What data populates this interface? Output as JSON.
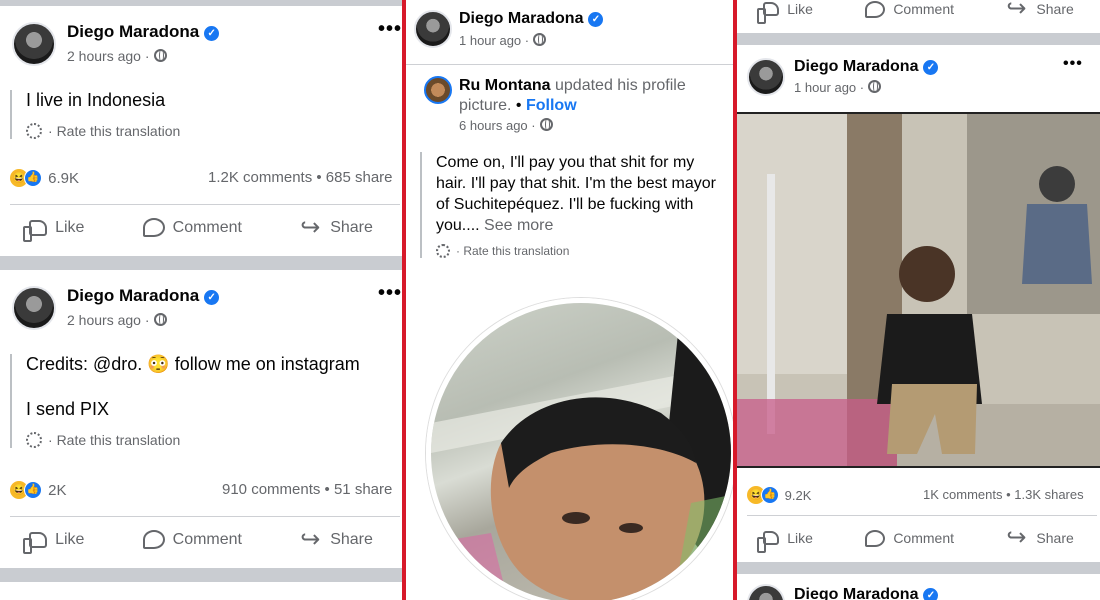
{
  "panel1": {
    "post1": {
      "author": "Diego Maradona",
      "time": "2 hours ago",
      "text": "I live in Indonesia",
      "rate": "Rate this translation",
      "reaction_count": "6.9K",
      "counts": "1.2K comments • 685 share"
    },
    "post2": {
      "author": "Diego Maradona",
      "time": "2 hours ago",
      "text_line1": "Credits: @dro. 😳 follow me on instagram",
      "text_line2": "I send PIX",
      "rate": "Rate this translation",
      "reaction_count": "2K",
      "counts": "910 comments • 51 share"
    }
  },
  "panel2": {
    "author": "Diego Maradona",
    "time": "1 hour ago",
    "shared_author": "Ru Montana",
    "shared_action_1": "updated his profile",
    "shared_action_2": "picture.",
    "follow": "Follow",
    "shared_time": "6 hours ago",
    "text_lines": [
      "Come on, I'll pay you that shit for my",
      "hair. I'll pay that shit. I'm the best mayor",
      "of Suchitepéquez. I'll be fucking with",
      "you...."
    ],
    "see_more": "See more",
    "rate": "Rate this translation"
  },
  "panel3": {
    "author": "Diego Maradona",
    "time": "1 hour ago",
    "reaction_count": "9.2K",
    "counts": "1K comments • 1.3K shares",
    "next_author": "Diego Maradona"
  },
  "actions": {
    "like": "Like",
    "comment": "Comment",
    "share": "Share"
  },
  "symbols": {
    "more": "•••",
    "verified": "✓",
    "dot": "·",
    "bullet": "•"
  },
  "icons": [
    "verified-badge-icon",
    "globe-icon",
    "more-options-icon",
    "gear-icon",
    "like-icon",
    "comment-icon",
    "share-icon",
    "haha-reaction-icon",
    "like-reaction-icon"
  ],
  "colors": {
    "accent": "#1877f2",
    "border_red": "#d7192a",
    "separator": "#c9ccd1",
    "meta_text": "#65676b"
  }
}
